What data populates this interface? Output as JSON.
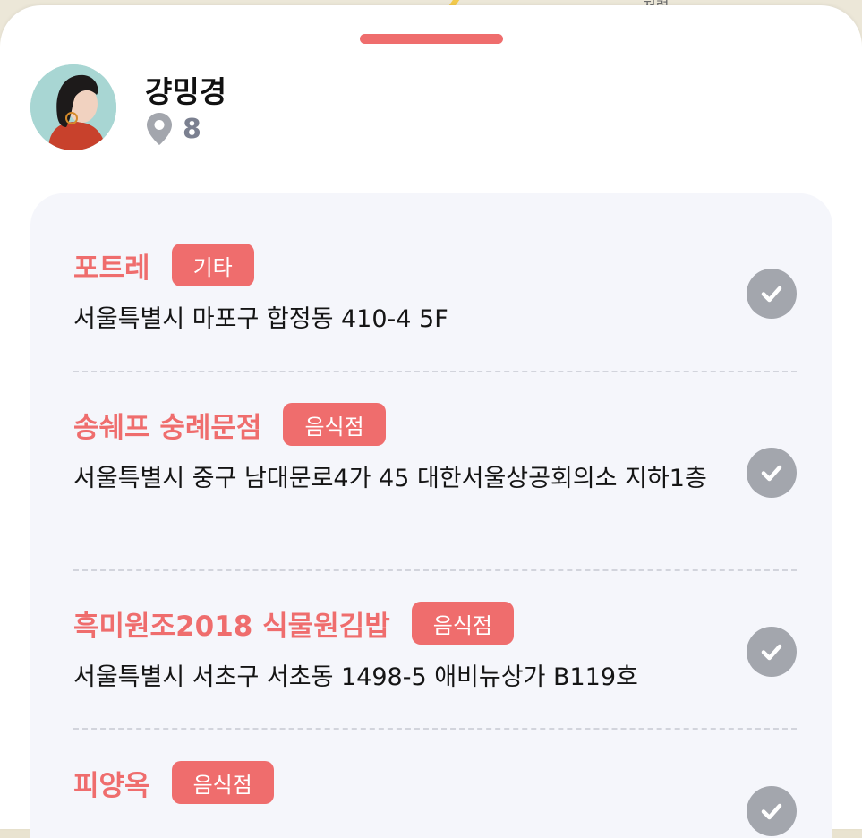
{
  "profile": {
    "name": "걍밍경",
    "pin_count": "8"
  },
  "map": {
    "partial_label": "저렬"
  },
  "places": [
    {
      "name": "포트레",
      "category": "기타",
      "address": "서울특별시 마포구 합정동 410-4 5F"
    },
    {
      "name": "송쉐프 숭례문점",
      "category": "음식점",
      "address": "서울특별시 중구 남대문로4가 45 대한서울상공회의소 지하1층"
    },
    {
      "name": "흑미원조2018 식물원김밥",
      "category": "음식점",
      "address": "서울특별시 서초구 서초동 1498-5 애비뉴상가 B119호"
    },
    {
      "name": "피양옥",
      "category": "음식점",
      "address": ""
    }
  ],
  "colors": {
    "accent": "#ef6d6d",
    "check_gray": "#a3a6ad",
    "card_bg": "#f5f6fb"
  },
  "icons": {
    "pin": "map-pin-icon",
    "check": "check-circle-icon"
  }
}
